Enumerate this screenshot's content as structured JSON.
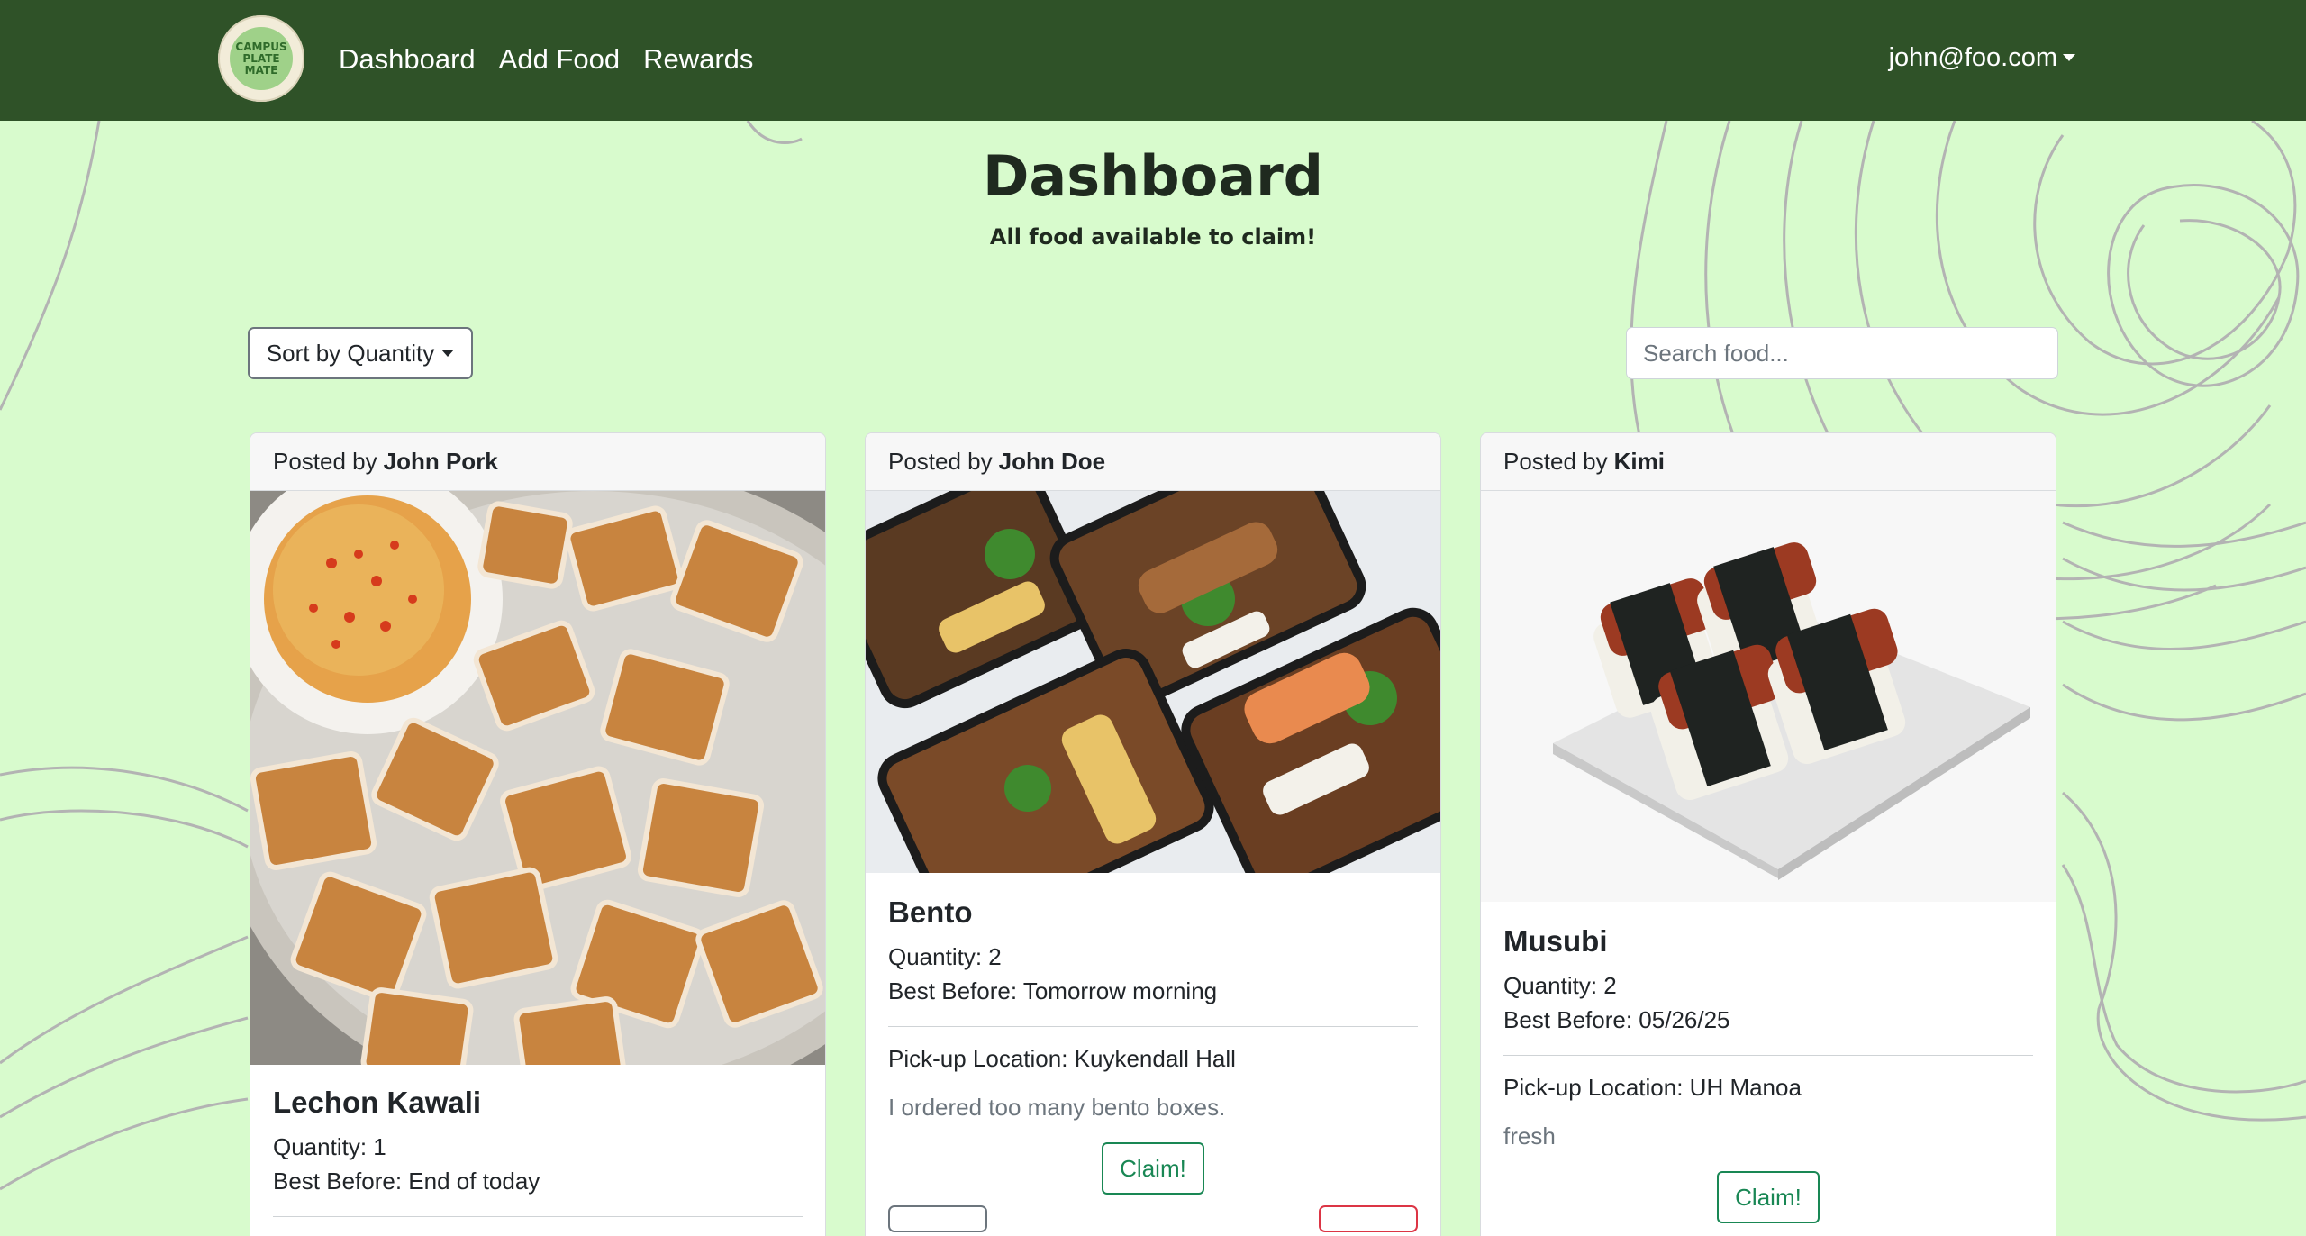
{
  "navbar": {
    "logo_lines": [
      "CAMPUS",
      "PLATE",
      "MATE"
    ],
    "links": [
      {
        "label": "Dashboard"
      },
      {
        "label": "Add Food"
      },
      {
        "label": "Rewards"
      }
    ],
    "user_email": "john@foo.com",
    "background": "#2f5228"
  },
  "header": {
    "title": "Dashboard",
    "subtitle": "All food available to claim!"
  },
  "controls": {
    "sort_label": "Sort by Quantity",
    "search_placeholder": "Search food..."
  },
  "cards": [
    {
      "posted_by_prefix": "Posted by",
      "poster": "John Pork",
      "name": "Lechon Kawali",
      "quantity": "Quantity: 1",
      "best_before": "Best Before: End of today"
    },
    {
      "posted_by_prefix": "Posted by",
      "poster": "John Doe",
      "name": "Bento",
      "quantity": "Quantity: 2",
      "best_before": "Best Before: Tomorrow morning",
      "location": "Pick-up Location: Kuykendall Hall",
      "description": "I ordered too many bento boxes.",
      "claim_label": "Claim!"
    },
    {
      "posted_by_prefix": "Posted by",
      "poster": "Kimi",
      "name": "Musubi",
      "quantity": "Quantity: 2",
      "best_before": "Best Before: 05/26/25",
      "location": "Pick-up Location: UH Manoa",
      "description": "fresh",
      "claim_label": "Claim!"
    }
  ],
  "colors": {
    "page_background": "#d8fbcd",
    "accent_green": "#198754",
    "contour_lines": "#b3b3b3"
  }
}
